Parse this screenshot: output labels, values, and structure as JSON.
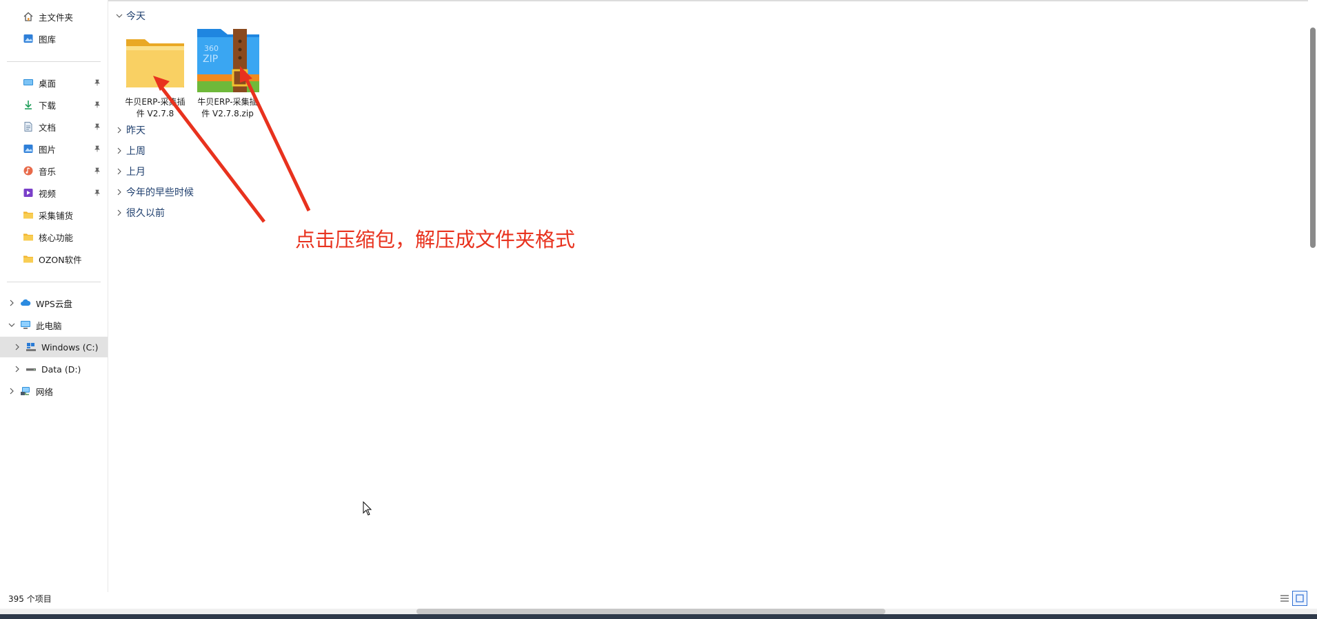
{
  "sidebar": {
    "quick": [
      {
        "label": "主文件夹",
        "icon": "home-icon"
      },
      {
        "label": "图库",
        "icon": "gallery-icon"
      }
    ],
    "pinned": [
      {
        "label": "桌面",
        "icon": "desktop-icon",
        "pinned": true
      },
      {
        "label": "下载",
        "icon": "download-icon",
        "pinned": true
      },
      {
        "label": "文档",
        "icon": "document-icon",
        "pinned": true
      },
      {
        "label": "图片",
        "icon": "picture-icon",
        "pinned": true
      },
      {
        "label": "音乐",
        "icon": "music-icon",
        "pinned": true
      },
      {
        "label": "视频",
        "icon": "video-icon",
        "pinned": true
      },
      {
        "label": "采集铺货",
        "icon": "folder-icon"
      },
      {
        "label": "核心功能",
        "icon": "folder-icon"
      },
      {
        "label": "OZON软件",
        "icon": "folder-icon"
      }
    ],
    "tree": [
      {
        "label": "WPS云盘",
        "icon": "cloud-icon",
        "expanded": false
      },
      {
        "label": "此电脑",
        "icon": "computer-icon",
        "expanded": true
      },
      {
        "label": "Windows (C:)",
        "icon": "windows-drive-icon",
        "expanded": false,
        "selected": true
      },
      {
        "label": "Data (D:)",
        "icon": "drive-icon",
        "expanded": false
      },
      {
        "label": "网络",
        "icon": "network-icon",
        "expanded": false
      }
    ]
  },
  "groups": {
    "today": "今天",
    "yesterday": "昨天",
    "last_week": "上周",
    "last_month": "上月",
    "earlier_this_year": "今年的早些时候",
    "long_ago": "很久以前"
  },
  "files": [
    {
      "name_line1": "牛贝ERP-采集插",
      "name_line2": "件 V2.7.8",
      "type": "folder"
    },
    {
      "name_line1": "牛贝ERP-采集插",
      "name_line2": "件 V2.7.8.zip",
      "type": "zip"
    }
  ],
  "zip_icon_text": {
    "brand": "360",
    "label": "ZIP"
  },
  "annotation": "点击压缩包，解压成文件夹格式",
  "status": "395 个项目",
  "colors": {
    "accent": "#e8321e",
    "selected": "#e2e2e2",
    "folder": "#f7c948"
  }
}
